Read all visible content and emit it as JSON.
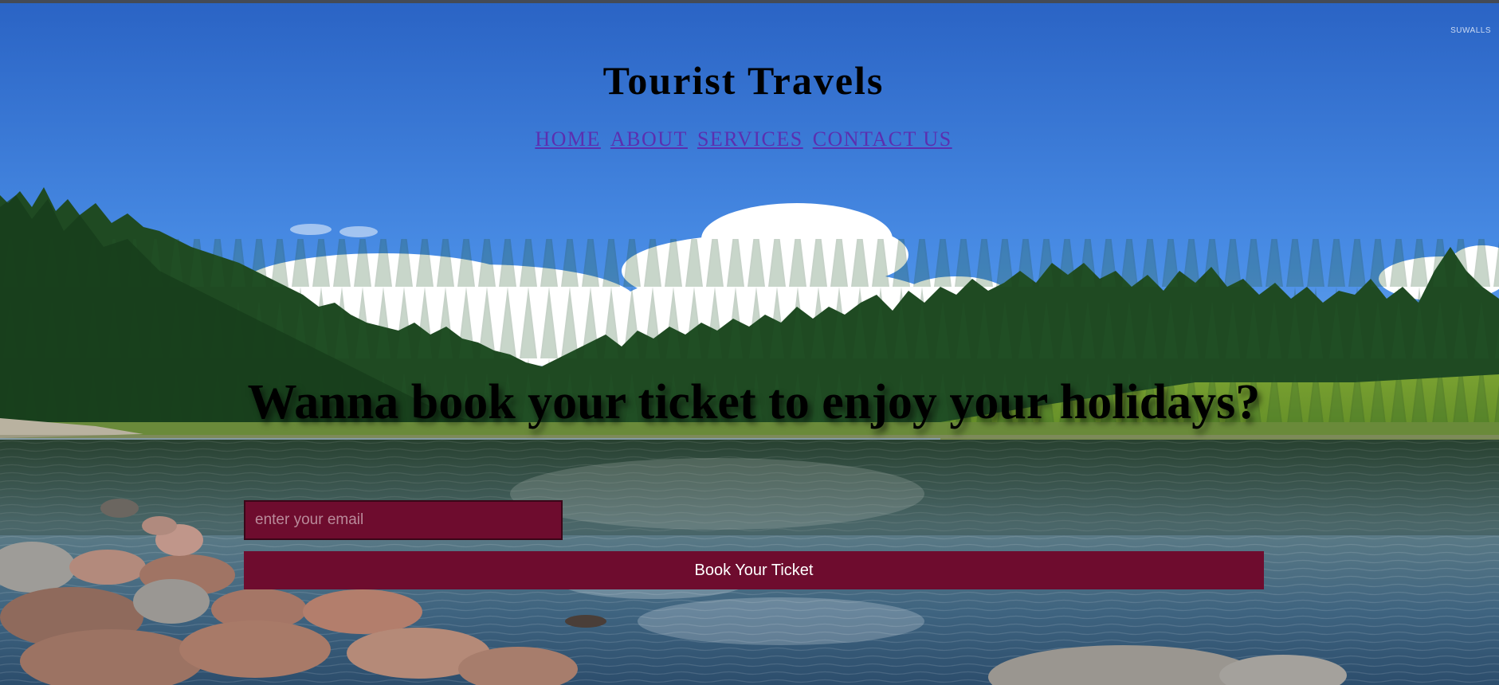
{
  "watermark": "SUWALLS",
  "site": {
    "title": "Tourist Travels"
  },
  "nav": {
    "items": [
      {
        "label": "HOME"
      },
      {
        "label": "ABOUT"
      },
      {
        "label": "SERVICES"
      },
      {
        "label": "CONTACT US"
      }
    ]
  },
  "hero": {
    "headline": "Wanna book your ticket to enjoy your holidays?",
    "email_placeholder": "enter your email",
    "email_value": "",
    "button_label": "Book Your Ticket"
  },
  "colors": {
    "accent": "#6e0c2e",
    "link": "#5b2fb0",
    "sky": "#2f6fd0",
    "forest": "#1f4a22",
    "water": "#3d5f6e"
  }
}
